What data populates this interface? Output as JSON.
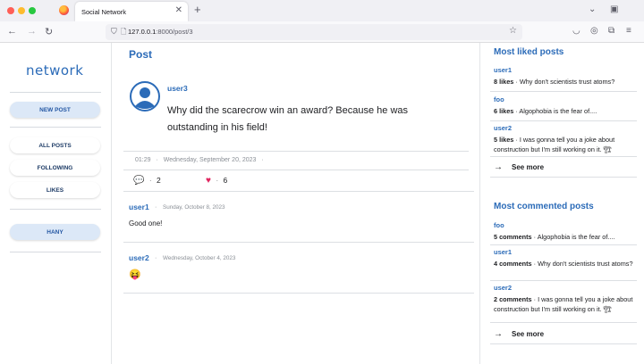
{
  "browser": {
    "tab_title": "Social Network",
    "tab_close": "✕",
    "new_tab": "+",
    "url_host": "127.0.0.1",
    "url_path": ":8000/post/3",
    "colors": {
      "close": "#ff5f57",
      "minimize": "#febc2e",
      "maximize": "#28c840"
    }
  },
  "sidebar": {
    "logo": "network",
    "new_post": "NEW POST",
    "nav": [
      "ALL POSTS",
      "FOLLOWING",
      "LIKES"
    ],
    "user": "HANY"
  },
  "main": {
    "title": "Post",
    "post": {
      "user": "user3",
      "body": "Why did the scarecrow win an award? Because he was outstanding in his field!",
      "time": "01:29",
      "date": "Wednesday, September 20, 2023",
      "comments": "2",
      "likes": "6"
    },
    "comments": [
      {
        "user": "user1",
        "date": "Sunday, October 8, 2023",
        "text": "Good one!"
      },
      {
        "user": "user2",
        "date": "Wednesday, October 4, 2023",
        "text": "😝"
      }
    ]
  },
  "right": {
    "liked_title": "Most liked posts",
    "liked": [
      {
        "user": "user1",
        "count": "8 likes",
        "text": "Why don't scientists trust atoms?"
      },
      {
        "user": "foo",
        "count": "6 likes",
        "text": "Algophobia is the fear of...."
      },
      {
        "user": "user2",
        "count": "5 likes",
        "text": "I was gonna tell you a joke about construction but I'm still working on it. 🏗"
      }
    ],
    "see_more": "See more",
    "commented_title": "Most commented posts",
    "commented": [
      {
        "user": "foo",
        "count": "5 comments",
        "text": "Algophobia is the fear of...."
      },
      {
        "user": "user1",
        "count": "4 comments",
        "text": "Why don't scientists trust atoms?"
      },
      {
        "user": "user2",
        "count": "2 comments",
        "text": "I was gonna tell you a joke about construction but I'm still working on it. 🏗"
      }
    ]
  }
}
